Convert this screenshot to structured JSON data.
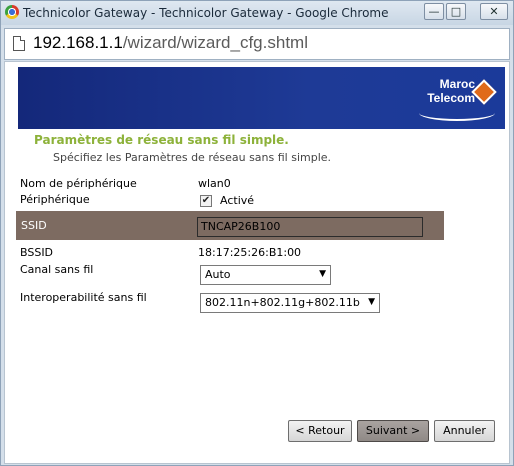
{
  "window": {
    "title": "Technicolor Gateway - Technicolor Gateway - Google Chrome",
    "min_glyph": "—",
    "max_glyph": "□",
    "close_glyph": "✕"
  },
  "address": {
    "host": "192.168.1.1",
    "path": "/wizard/wizard_cfg.shtml"
  },
  "brand": {
    "logo_line1": "Maroc",
    "logo_line2": "Telecom",
    "banner_color": "#1b3391",
    "logo_mark_color": "#e06a1a"
  },
  "section": {
    "title": "Paramètres de réseau sans fil simple.",
    "subtitle": "Spécifiez les Paramètres de réseau sans fil simple."
  },
  "form": {
    "device_name_label": "Nom de périphérique",
    "device_name_value": "wlan0",
    "device_label": "Périphérique",
    "device_checked_glyph": "✔",
    "device_value": "Activé",
    "ssid_label": "SSID",
    "ssid_value": "TNCAP26B100",
    "bssid_label": "BSSID",
    "bssid_value": "18:17:25:26:B1:00",
    "channel_label": "Canal sans fil",
    "channel_value": "Auto",
    "interop_label": "Interoperabilité sans fil",
    "interop_value": "802.11n+802.11g+802.11b",
    "caret_glyph": "▼"
  },
  "buttons": {
    "back": "< Retour",
    "next": "Suivant >",
    "cancel": "Annuler"
  }
}
